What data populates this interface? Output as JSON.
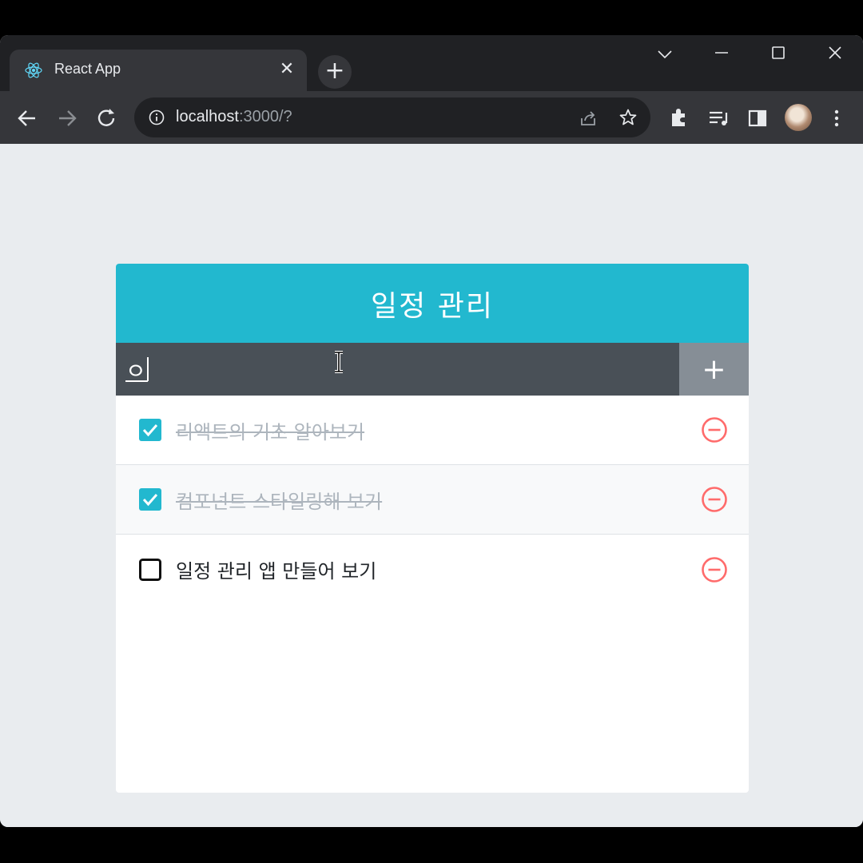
{
  "browser": {
    "tab_title": "React App",
    "url_host": "localhost",
    "url_rest": ":3000/?",
    "accent": "#202124"
  },
  "app": {
    "title": "일정 관리",
    "input_value": "ㅇ",
    "add_label": "+",
    "colors": {
      "header": "#22b8cf",
      "insert_bg": "#495057",
      "insert_btn": "#868e96",
      "remove": "#ff6b6b"
    },
    "todos": [
      {
        "text": "리액트의 기초 알아보기",
        "checked": true
      },
      {
        "text": "컴포넌트 스타일링해 보기",
        "checked": true
      },
      {
        "text": "일정 관리 앱 만들어 보기",
        "checked": false
      }
    ]
  }
}
